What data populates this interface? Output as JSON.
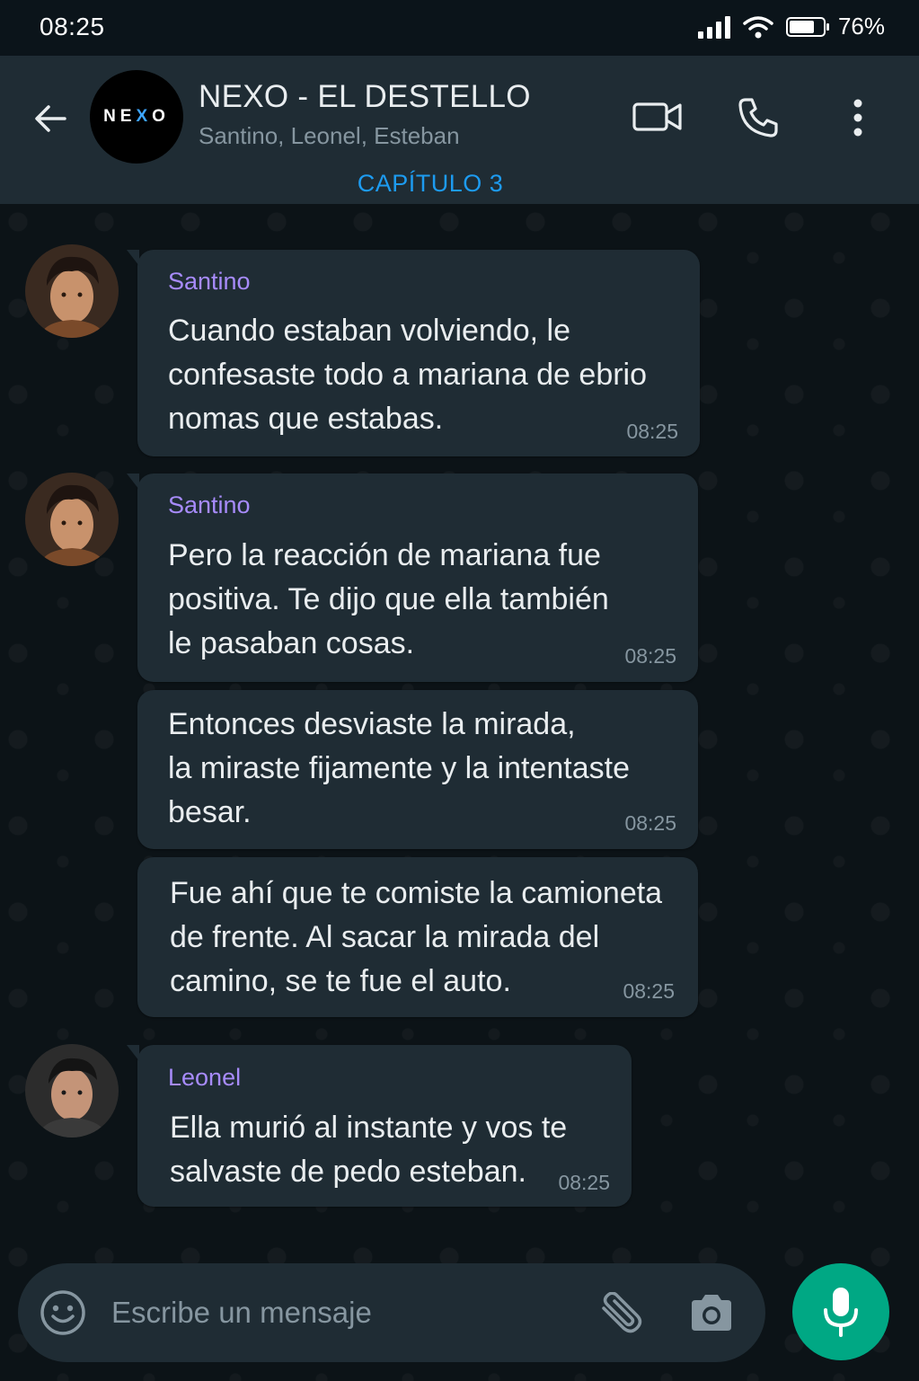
{
  "status_bar": {
    "time": "08:25",
    "battery": "76%",
    "battery_level": 0.76
  },
  "header": {
    "avatar_text_left": "NE",
    "avatar_text_x": "X",
    "avatar_text_right": "O",
    "title": "NEXO - EL DESTELLO",
    "members": "Santino, Leonel, Esteban",
    "chapter": "CAPÍTULO 3"
  },
  "messages": [
    {
      "sender": "Santino",
      "text": "Cuando estaban volviendo, le\nconfesaste todo a mariana de ebrio\nnomas que estabas.",
      "time": "08:25"
    },
    {
      "sender": "Santino",
      "text": "Pero la reacción de mariana fue\npositiva. Te dijo que ella también\nle pasaban cosas.",
      "time": "08:25"
    },
    {
      "sender": "",
      "text": "Entonces desviaste la mirada,\nla miraste fijamente y la intentaste\nbesar.",
      "time": "08:25"
    },
    {
      "sender": "",
      "text": "Fue ahí que te comiste la camioneta\nde frente. Al sacar la mirada del\ncamino, se te fue el auto.",
      "time": "08:25"
    },
    {
      "sender": "Leonel",
      "text": "Ella murió al instante y vos te\nsalvaste de pedo esteban.",
      "time": "08:25"
    }
  ],
  "composer": {
    "placeholder": "Escribe un mensaje"
  },
  "colors": {
    "accent": "#00a884",
    "sender_name": "#a78bfa",
    "chapter": "#1d9bf0",
    "bubble": "#1f2c34"
  },
  "icons": [
    "back-arrow-icon",
    "video-call-icon",
    "phone-icon",
    "more-vert-icon",
    "emoji-icon",
    "attach-icon",
    "camera-icon",
    "mic-icon",
    "signal-icon",
    "wifi-icon",
    "battery-icon"
  ]
}
